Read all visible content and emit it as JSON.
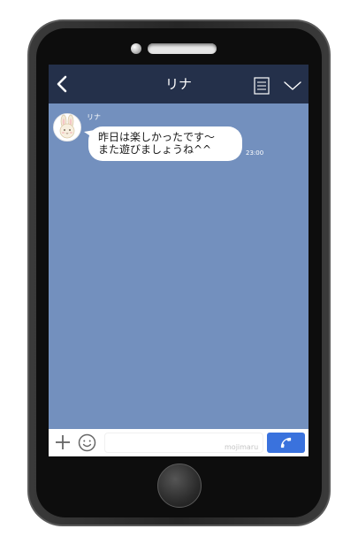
{
  "header": {
    "title": "リナ",
    "back_icon": "chevron-left-icon",
    "menu_icon": "note-list-icon",
    "dropdown_icon": "chevron-down-icon"
  },
  "chat": {
    "messages": [
      {
        "sender": "リナ",
        "avatar_icon": "bunny-avatar",
        "lines": [
          "昨日は楽しかったです〜",
          "また遊びましょうね^^"
        ],
        "time": "23:00"
      }
    ]
  },
  "input_bar": {
    "plus_icon": "plus-icon",
    "emoji_icon": "smile-icon",
    "placeholder": "",
    "value": "",
    "watermark": "mojimaru",
    "call_icon": "phone-icon"
  },
  "colors": {
    "header_bg": "#24304a",
    "chat_bg": "#7390be",
    "bubble_bg": "#ffffff",
    "call_button": "#3a72dd",
    "phone_body": "#2b2b2b"
  }
}
